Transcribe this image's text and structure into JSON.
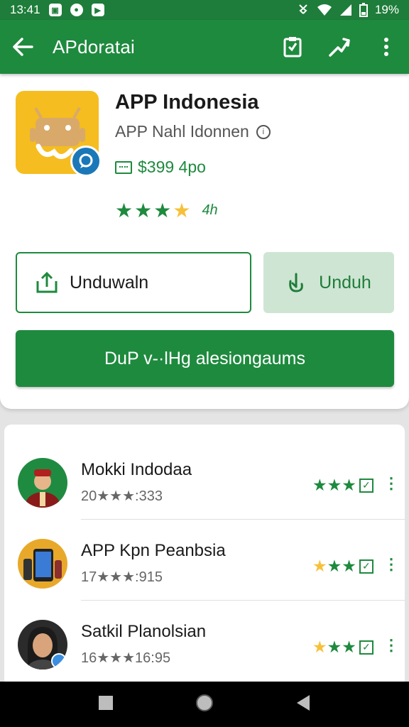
{
  "status_bar": {
    "time": "13:41",
    "battery": "19%",
    "icons": [
      "gallery-icon",
      "location-icon",
      "play-icon",
      "vibrate-icon",
      "wifi-icon",
      "signal-icon",
      "battery-icon"
    ]
  },
  "app_bar": {
    "title": "APdoratai",
    "back_icon": "back-arrow-icon",
    "action_icons": [
      "bookmark-check-icon",
      "share-icon",
      "more-vert-icon"
    ]
  },
  "app_detail": {
    "name": "APP Indonesia",
    "developer": "APP  Nahl Idonnen",
    "price": "$399 4po",
    "rating_label": "4h",
    "stars": [
      "full-green",
      "full-green",
      "full-green",
      "full-yellow"
    ]
  },
  "buttons": {
    "outline_label": "Unduwaln",
    "light_label": "Unduh",
    "primary_label": "DuP v-·lHg alesiongaums"
  },
  "list": [
    {
      "title": "Mokki Indodaa",
      "subtitle": "20★★★:333",
      "stars": [
        "g",
        "g",
        "g"
      ]
    },
    {
      "title": "APP Kpn Peanbsia",
      "subtitle": "17★★★:915",
      "stars": [
        "y",
        "g",
        "g"
      ]
    },
    {
      "title": "Satkil Planolsian",
      "subtitle": "16★★★16:95",
      "stars": [
        "y",
        "g",
        "g"
      ]
    }
  ],
  "colors": {
    "primary": "#1e8a3e",
    "status_bar": "#1e7d3a",
    "star_yellow": "#f6c13a",
    "app_icon_bg": "#f5bd1f"
  }
}
